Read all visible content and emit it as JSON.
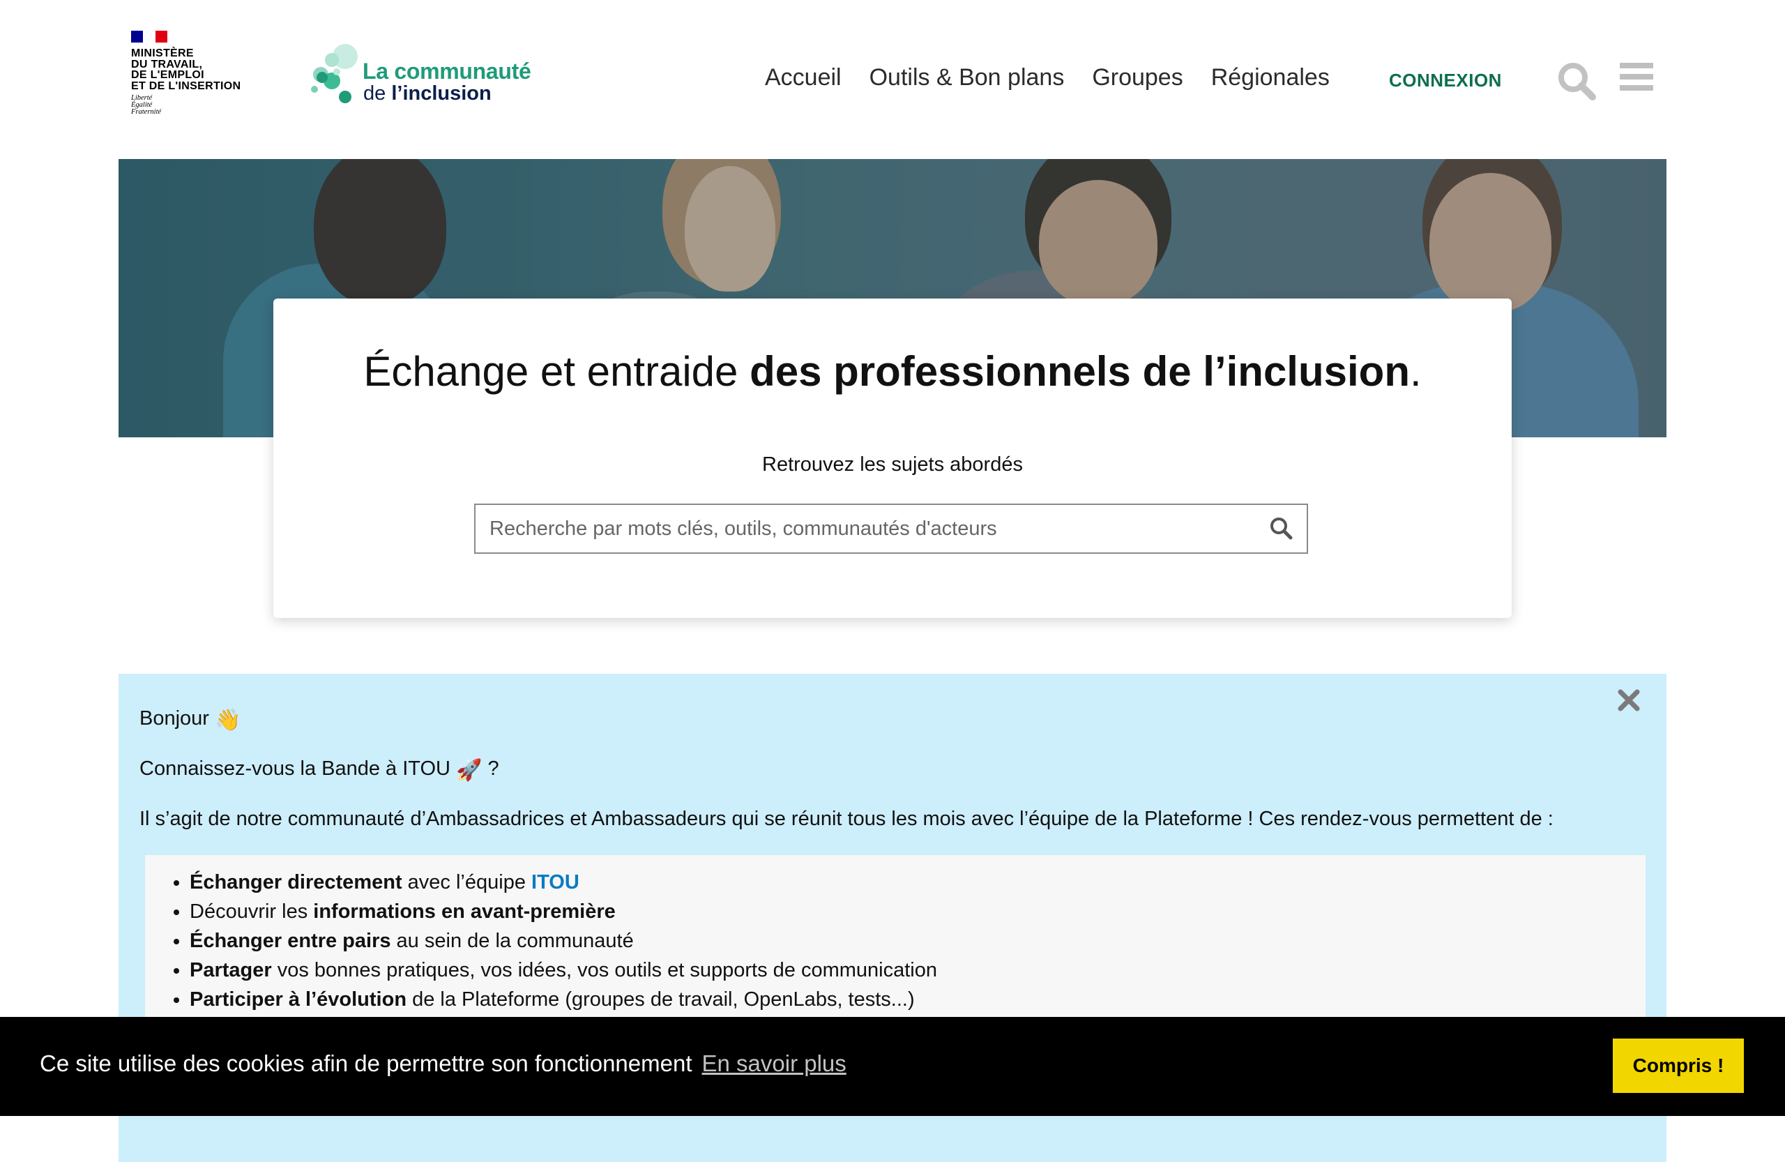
{
  "header": {
    "gouv_logo": {
      "ministry": "MINISTÈRE\nDU TRAVAIL,\nDE L'EMPLOI\nET DE L'INSERTION",
      "motto": "Liberté\nÉgalité\nFraternité"
    },
    "brand": {
      "line1": "La communauté",
      "line2_prefix": "de",
      "line2_bold": "l’inclusion"
    },
    "nav": [
      "Accueil",
      "Outils & Bon plans",
      "Groupes",
      "Régionales"
    ],
    "login_label": "CONNEXION",
    "icons": {
      "search": "search-icon",
      "menu": "hamburger-menu-icon"
    }
  },
  "hero": {
    "title_regular": "Échange et entraide ",
    "title_bold": "des professionnels de l’inclusion",
    "title_end": ".",
    "search_label": "Retrouvez les sujets abordés",
    "search_placeholder": "Recherche par mots clés, outils, communautés d'acteurs",
    "search_value": ""
  },
  "notice": {
    "greeting": "Bonjour",
    "greeting_emoji": "👋",
    "question": "Connaissez-vous la Bande à ITOU",
    "question_emoji": "🚀",
    "question_end": " ?",
    "intro": "Il s’agit de notre communauté d’Ambassadrices et Ambassadeurs qui se réunit tous les mois avec l’équipe de la Plateforme ! Ces rendez-vous permettent de :",
    "bullets": [
      {
        "bold": "Échanger directement",
        "text": " avec l’équipe ",
        "link": "ITOU"
      },
      {
        "pre": "Découvrir les ",
        "bold": "informations en avant-première"
      },
      {
        "bold": "Échanger entre pairs",
        "text": " au sein de la communauté"
      },
      {
        "bold": "Partager",
        "text": " vos bonnes pratiques, vos idées, vos outils et supports de communication"
      },
      {
        "bold": "Participer à l’évolution",
        "text": " de la Plateforme (groupes de travail, OpenLabs, tests...)"
      }
    ]
  },
  "cookie": {
    "message": "Ce site utilise des cookies afin de permettre son fonctionnement",
    "more_link": "En savoir plus",
    "accept": "Compris !"
  },
  "colors": {
    "brand_green": "#1f9b79",
    "login_green": "#0e6e4e",
    "notice_bg": "#cdeefb",
    "cookie_button": "#f1d600",
    "link_blue": "#0a7bc1"
  }
}
